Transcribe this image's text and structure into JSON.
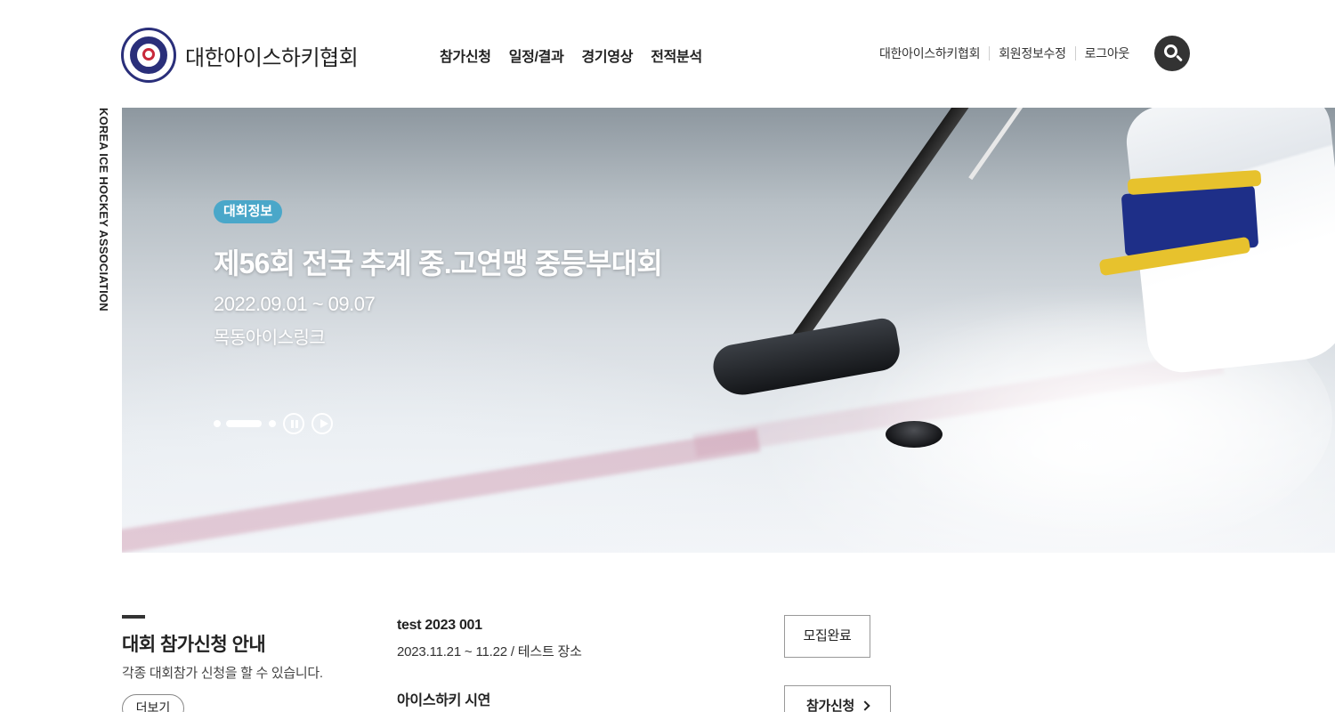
{
  "header": {
    "logo_text": "대한아이스하키협회",
    "logo_emblem_text": "KOREA ICE HOCKEY ASSOCIATION 1928",
    "gnb": [
      "참가신청",
      "일정/결과",
      "경기영상",
      "전적분석"
    ],
    "util": [
      "대한아이스하키협회",
      "회원정보수정",
      "로그아웃"
    ],
    "search_icon": "search-icon"
  },
  "side_label": "KOREA ICE HOCKEY ASSOCIATION",
  "hero": {
    "badge": "대회정보",
    "title": "제56회 전국 추계 중.고연맹 중등부대회",
    "date": "2022.09.01 ~ 09.07",
    "place": "목동아이스링크",
    "pager": {
      "dots": 3,
      "active_index": 1,
      "controls": [
        "pause-icon",
        "play-icon"
      ]
    }
  },
  "notice": {
    "title": "대회 참가신청 안내",
    "desc": "각종 대회참가 신청을 할 수 있습니다.",
    "more_label": "더보기",
    "events": [
      {
        "name": "test 2023 001",
        "meta": "2023.11.21 ~ 11.22 / 테스트 장소",
        "status": "모집완료"
      },
      {
        "name": "아이스하키 시연",
        "meta": "",
        "status": "참가신청"
      }
    ]
  },
  "colors": {
    "badge": "#4aa7c9",
    "logo_navy": "#2a2f7a",
    "logo_red": "#c8283a",
    "search_bg": "#333333"
  }
}
